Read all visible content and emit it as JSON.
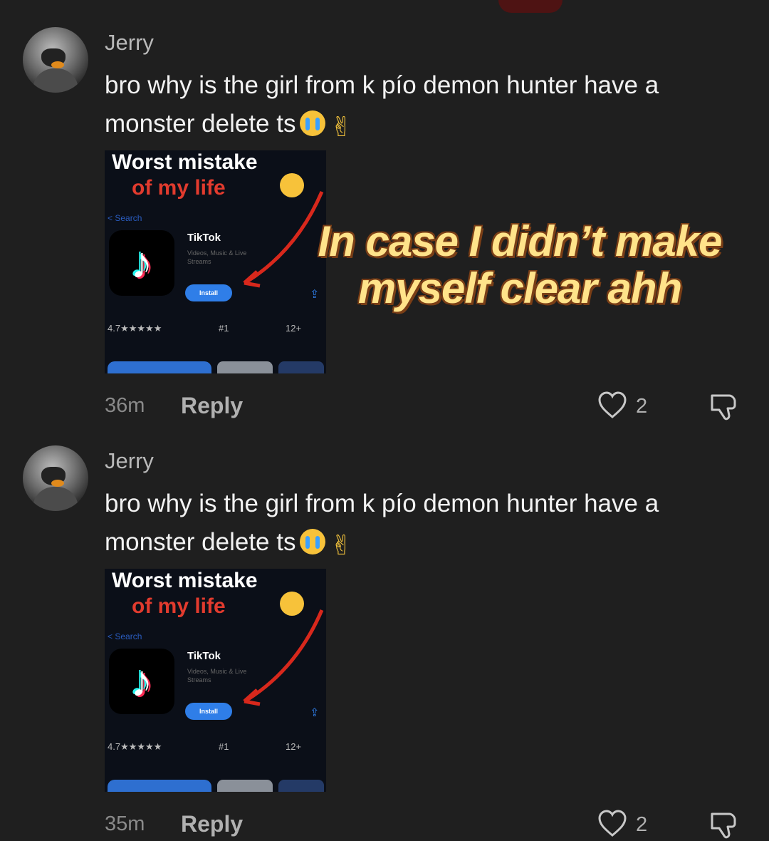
{
  "comments": [
    {
      "username": "Jerry",
      "text": "bro why is the girl from k pío demon hunter have a monster delete ts",
      "time": "36m",
      "reply_label": "Reply",
      "likes": "2",
      "media": {
        "title_line1": "Worst mistake",
        "title_line2": "of my life",
        "back": "< Search",
        "app_name": "TikTok",
        "app_sub": "Videos, Music & Live Streams",
        "install": "Install",
        "rating": "4.7★★★★★",
        "rank": "#1",
        "age": "12+"
      }
    },
    {
      "username": "Jerry",
      "text": "bro why is the girl from k pío demon hunter have a monster delete ts",
      "time": "35m",
      "reply_label": "Reply",
      "likes": "2",
      "media": {
        "title_line1": "Worst mistake",
        "title_line2": "of my life",
        "back": "< Search",
        "app_name": "TikTok",
        "app_sub": "Videos, Music & Live Streams",
        "install": "Install",
        "rating": "4.7★★★★★",
        "rank": "#1",
        "age": "12+"
      }
    }
  ],
  "overlay": {
    "line1": "In case I didn’t make",
    "line2": "myself clear ahh"
  },
  "emoji": {
    "sob": "loudly-crying-face-icon",
    "peace": "✌"
  },
  "colors": {
    "background": "#1f1f1f",
    "overlay_text": "#ffe38a",
    "overlay_outline": "#7a3e16",
    "arrow": "#d8281c"
  }
}
